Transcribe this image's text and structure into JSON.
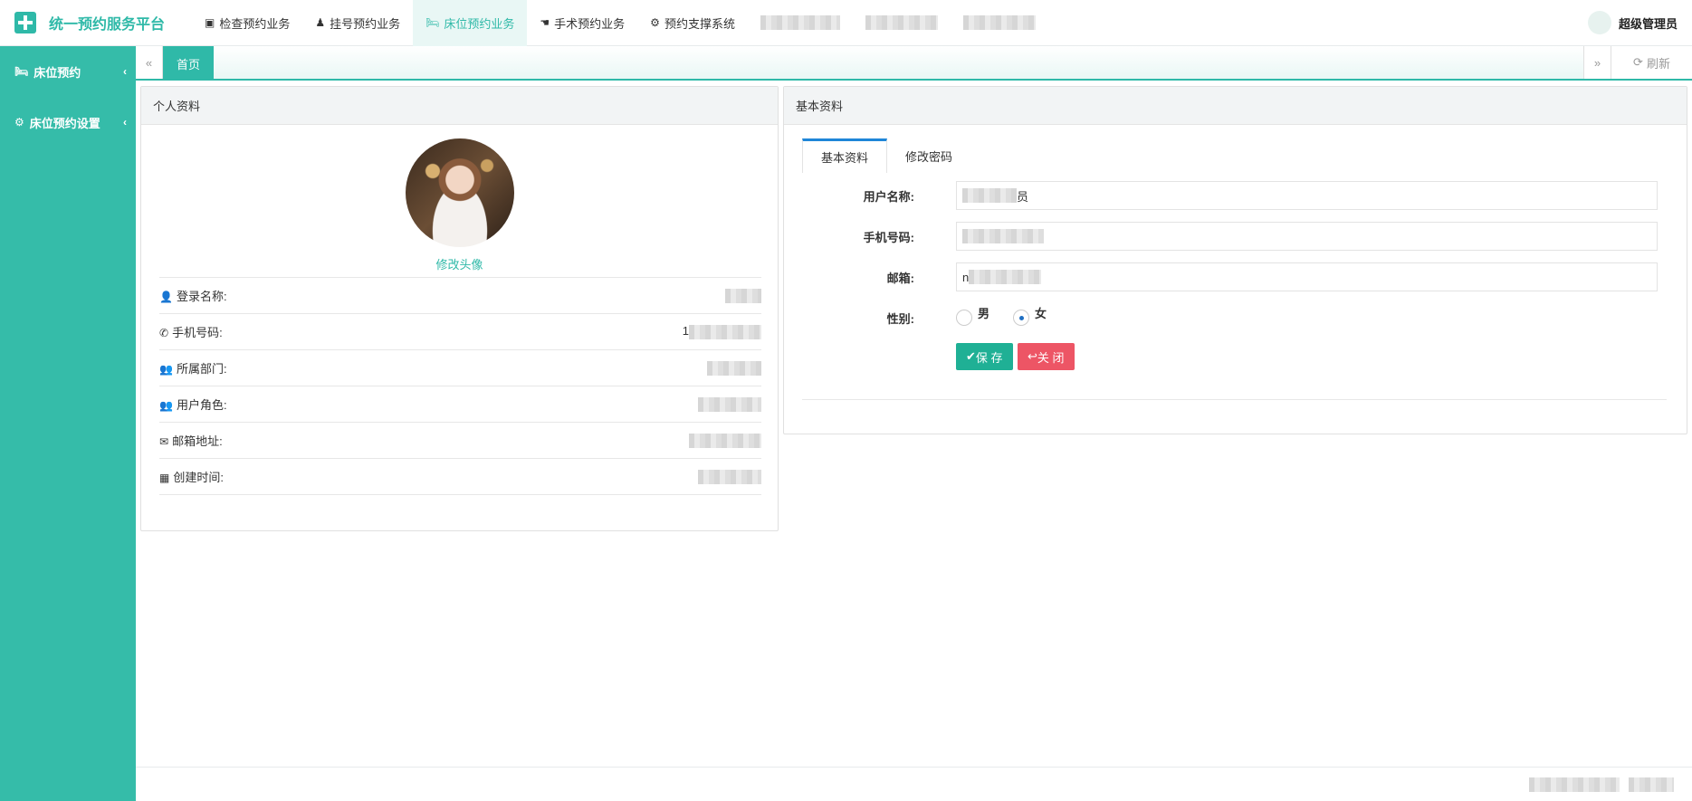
{
  "app": {
    "title": "统一预约服务平台",
    "brand_color": "#2fb9a8"
  },
  "nav": {
    "items": [
      {
        "label": "检查预约业务",
        "icon": "id-card-icon"
      },
      {
        "label": "挂号预约业务",
        "icon": "person-icon"
      },
      {
        "label": "床位预约业务",
        "icon": "bed-icon",
        "active": true
      },
      {
        "label": "手术预约业务",
        "icon": "hand-icon"
      },
      {
        "label": "预约支撑系统",
        "icon": "gear-icon"
      }
    ]
  },
  "user": {
    "name": "超级管理员"
  },
  "sidebar": {
    "items": [
      {
        "label": "床位预约",
        "icon": "bed-icon"
      },
      {
        "label": "床位预约设置",
        "icon": "gears-icon"
      }
    ]
  },
  "tabs_bar": {
    "home": "首页",
    "refresh": "刷新"
  },
  "profile_panel": {
    "title": "个人资料",
    "edit_avatar": "修改头像",
    "rows": [
      {
        "label": "登录名称:",
        "icon": "user-icon",
        "value": ""
      },
      {
        "label": "手机号码:",
        "icon": "phone-icon",
        "value": "1"
      },
      {
        "label": "所属部门:",
        "icon": "users-icon",
        "value": ""
      },
      {
        "label": "用户角色:",
        "icon": "users-icon",
        "value": ""
      },
      {
        "label": "邮箱地址:",
        "icon": "envelope-icon",
        "value": ""
      },
      {
        "label": "创建时间:",
        "icon": "calendar-icon",
        "value": ""
      }
    ]
  },
  "basic_panel": {
    "title": "基本资料",
    "tabs": [
      "基本资料",
      "修改密码"
    ],
    "fields": {
      "username_label": "用户名称:",
      "username_value": "员",
      "phone_label": "手机号码:",
      "phone_value": "",
      "email_label": "邮箱:",
      "email_value": "n",
      "gender_label": "性别:",
      "gender_options": [
        "男",
        "女"
      ],
      "gender_selected": "女"
    },
    "buttons": {
      "save": "保 存",
      "close": "关 闭"
    }
  }
}
